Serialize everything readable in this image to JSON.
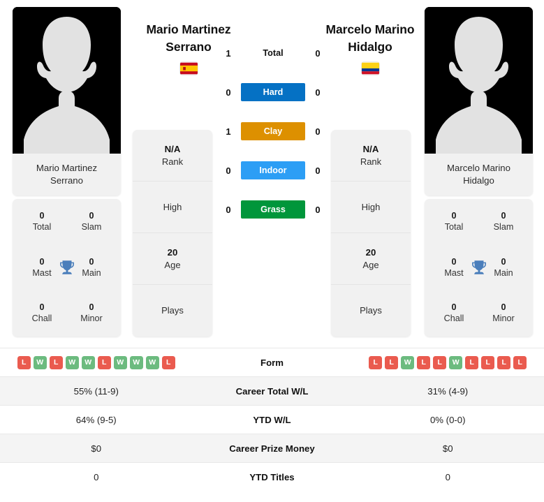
{
  "players": {
    "left": {
      "name": "Mario Martinez Serrano",
      "name_line1": "Mario Martinez",
      "name_line2": "Serrano",
      "country": "Spain",
      "flag_icon": "flag-spain",
      "photo_caption_line1": "Mario Martinez",
      "photo_caption_line2": "Serrano",
      "titles": {
        "total_value": "0",
        "total_label": "Total",
        "slam_value": "0",
        "slam_label": "Slam",
        "mast_value": "0",
        "mast_label": "Mast",
        "main_value": "0",
        "main_label": "Main",
        "chall_value": "0",
        "chall_label": "Chall",
        "minor_value": "0",
        "minor_label": "Minor"
      },
      "info": {
        "rank_value": "N/A",
        "rank_label": "Rank",
        "high_value": "",
        "high_label": "High",
        "age_value": "20",
        "age_label": "Age",
        "plays_value": "",
        "plays_label": "Plays"
      },
      "form": [
        "L",
        "W",
        "L",
        "W",
        "W",
        "L",
        "W",
        "W",
        "W",
        "L"
      ],
      "career_total_wl": "55% (11-9)",
      "ytd_wl": "64% (9-5)",
      "career_prize_money": "$0",
      "ytd_titles": "0"
    },
    "right": {
      "name": "Marcelo Marino Hidalgo",
      "name_line1": "Marcelo Marino",
      "name_line2": "Hidalgo",
      "country": "Colombia",
      "flag_icon": "flag-colombia",
      "photo_caption_line1": "Marcelo Marino",
      "photo_caption_line2": "Hidalgo",
      "titles": {
        "total_value": "0",
        "total_label": "Total",
        "slam_value": "0",
        "slam_label": "Slam",
        "mast_value": "0",
        "mast_label": "Mast",
        "main_value": "0",
        "main_label": "Main",
        "chall_value": "0",
        "chall_label": "Chall",
        "minor_value": "0",
        "minor_label": "Minor"
      },
      "info": {
        "rank_value": "N/A",
        "rank_label": "Rank",
        "high_value": "",
        "high_label": "High",
        "age_value": "20",
        "age_label": "Age",
        "plays_value": "",
        "plays_label": "Plays"
      },
      "form": [
        "L",
        "L",
        "W",
        "L",
        "L",
        "W",
        "L",
        "L",
        "L",
        "L"
      ],
      "career_total_wl": "31% (4-9)",
      "ytd_wl": "0% (0-0)",
      "career_prize_money": "$0",
      "ytd_titles": "0"
    }
  },
  "head_to_head": {
    "rows": [
      {
        "label": "Total",
        "left": "1",
        "right": "0",
        "color": "",
        "plain": true
      },
      {
        "label": "Hard",
        "left": "0",
        "right": "0",
        "color": "#0571c4",
        "plain": false
      },
      {
        "label": "Clay",
        "left": "1",
        "right": "0",
        "color": "#dd9000",
        "plain": false
      },
      {
        "label": "Indoor",
        "left": "0",
        "right": "0",
        "color": "#2c9ef5",
        "plain": false
      },
      {
        "label": "Grass",
        "left": "0",
        "right": "0",
        "color": "#00963b",
        "plain": false
      }
    ]
  },
  "stats_table": {
    "rows": [
      {
        "label": "Form",
        "type": "form",
        "left": "",
        "right": ""
      },
      {
        "label": "Career Total W/L",
        "type": "text",
        "left": "55% (11-9)",
        "right": "31% (4-9)"
      },
      {
        "label": "YTD W/L",
        "type": "text",
        "left": "64% (9-5)",
        "right": "0% (0-0)"
      },
      {
        "label": "Career Prize Money",
        "type": "text",
        "left": "$0",
        "right": "$0"
      },
      {
        "label": "YTD Titles",
        "type": "text",
        "left": "0",
        "right": "0"
      }
    ]
  },
  "colors": {
    "hard": "#0571c4",
    "clay": "#dd9000",
    "indoor": "#2c9ef5",
    "grass": "#00963b",
    "win_badge": "#6cbb7f",
    "loss_badge": "#ea5b4f",
    "card_bg": "#f1f1f1",
    "row_shade": "#f4f4f4",
    "trophy": "#4a7ebb"
  },
  "icons": {
    "trophy": "trophy-icon"
  }
}
